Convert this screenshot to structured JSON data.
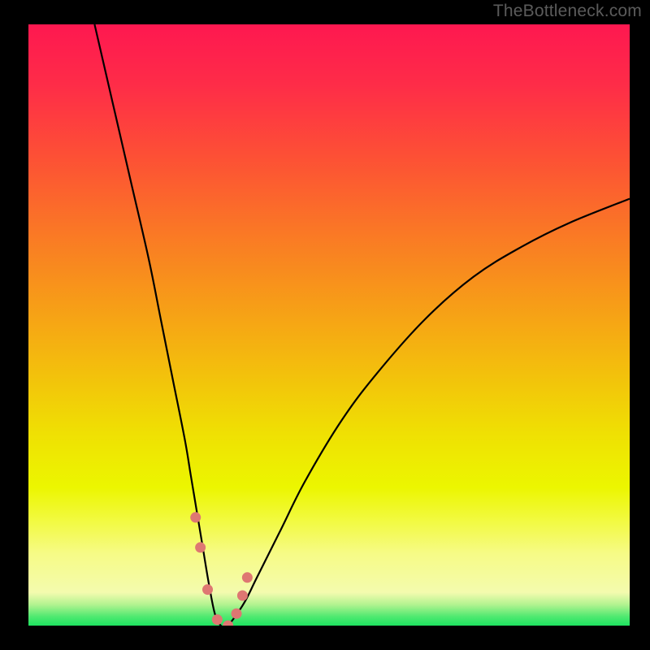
{
  "watermark": "TheBottleneck.com",
  "chart_data": {
    "type": "line",
    "title": "",
    "xlabel": "",
    "ylabel": "",
    "xlim": [
      0,
      100
    ],
    "ylim": [
      0,
      100
    ],
    "curve": {
      "x": [
        11,
        14,
        17,
        20,
        22,
        24,
        26,
        27,
        28,
        29,
        30,
        31,
        32,
        33,
        34,
        36,
        38,
        42,
        46,
        52,
        58,
        66,
        74,
        82,
        90,
        100
      ],
      "y": [
        100,
        87,
        74,
        61,
        51,
        41,
        31,
        25,
        19,
        13,
        7,
        2,
        0,
        0,
        1,
        4,
        8,
        16,
        24,
        34,
        42,
        51,
        58,
        63,
        67,
        71
      ]
    },
    "markers": {
      "x": [
        27.8,
        28.6,
        29.8,
        31.4,
        33.2,
        34.6,
        35.6,
        36.4
      ],
      "y": [
        18,
        13,
        6,
        1,
        0,
        2,
        5,
        8
      ]
    },
    "marker_color": "#de7772",
    "marker_size_px": 13,
    "gradient_stops": [
      {
        "offset": 0.0,
        "color": "#fe1850"
      },
      {
        "offset": 0.1,
        "color": "#fe2c48"
      },
      {
        "offset": 0.22,
        "color": "#fd5035"
      },
      {
        "offset": 0.34,
        "color": "#fa7626"
      },
      {
        "offset": 0.46,
        "color": "#f79b18"
      },
      {
        "offset": 0.58,
        "color": "#f3c00c"
      },
      {
        "offset": 0.68,
        "color": "#efe003"
      },
      {
        "offset": 0.77,
        "color": "#ecf600"
      },
      {
        "offset": 0.83,
        "color": "#f2fa46"
      },
      {
        "offset": 0.88,
        "color": "#f6fb86"
      },
      {
        "offset": 0.945,
        "color": "#f4fbae"
      },
      {
        "offset": 0.965,
        "color": "#b2f390"
      },
      {
        "offset": 0.985,
        "color": "#4fe970"
      },
      {
        "offset": 1.0,
        "color": "#1ee360"
      }
    ]
  }
}
